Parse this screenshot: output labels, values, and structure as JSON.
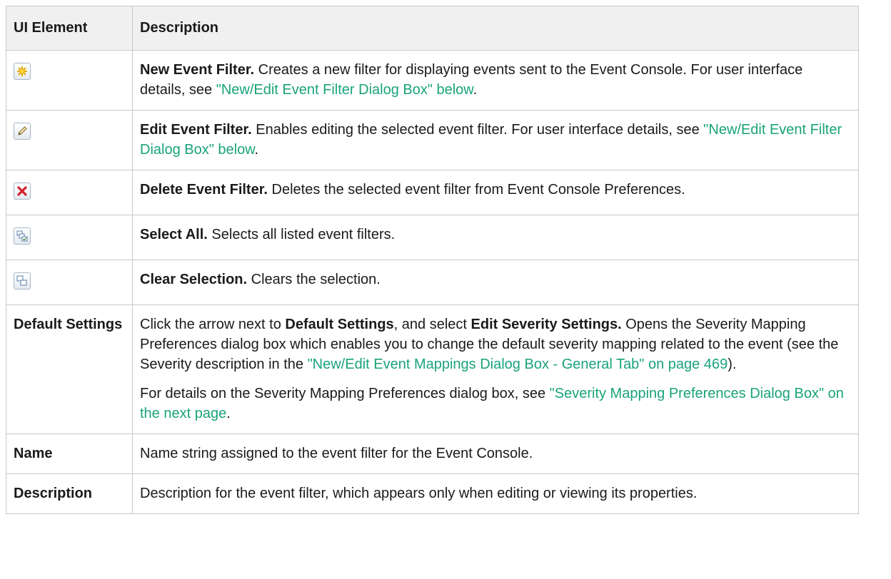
{
  "header": {
    "col_element": "UI Element",
    "col_description": "Description"
  },
  "rows": [
    {
      "icon": "new-filter-star-icon",
      "title": "New Event Filter.",
      "text": " Creates a new filter for displaying events sent to the Event Console. For user interface details, see ",
      "link": "\"New/Edit Event Filter Dialog Box\" below",
      "tail": "."
    },
    {
      "icon": "edit-pencil-icon",
      "title": "Edit Event Filter.",
      "text": " Enables editing the selected event filter. For user interface details, see ",
      "link": "\"New/Edit Event Filter Dialog Box\" below",
      "tail": "."
    },
    {
      "icon": "delete-x-icon",
      "title": "Delete Event Filter.",
      "text": " Deletes the selected event filter from Event Console Preferences."
    },
    {
      "icon": "select-all-icon",
      "title": "Select All.",
      "text": " Selects all listed event filters."
    },
    {
      "icon": "clear-selection-icon",
      "title": "Clear Selection.",
      "text": " Clears the selection."
    }
  ],
  "default_settings": {
    "element": "Default Settings",
    "p1_a": "Click the arrow next to ",
    "p1_b": "Default Settings",
    "p1_c": ", and select ",
    "p1_d": "Edit Severity Settings.",
    "p1_e": " Opens the Severity Mapping Preferences dialog box which enables you to change the default severity mapping related to the event (see the Severity description in the ",
    "p1_link": "\"New/Edit Event Mappings Dialog Box - General Tab\" on page 469",
    "p1_tail": ").",
    "p2_a": "For details on the Severity Mapping Preferences dialog box, see ",
    "p2_link": "\"Severity Mapping Preferences Dialog Box\" on the next page",
    "p2_tail": "."
  },
  "name_row": {
    "element": "Name",
    "text": "Name string assigned to the event filter for the Event Console."
  },
  "description_row": {
    "element": "Description",
    "text": "Description for the event filter, which appears only when editing or viewing its properties."
  }
}
